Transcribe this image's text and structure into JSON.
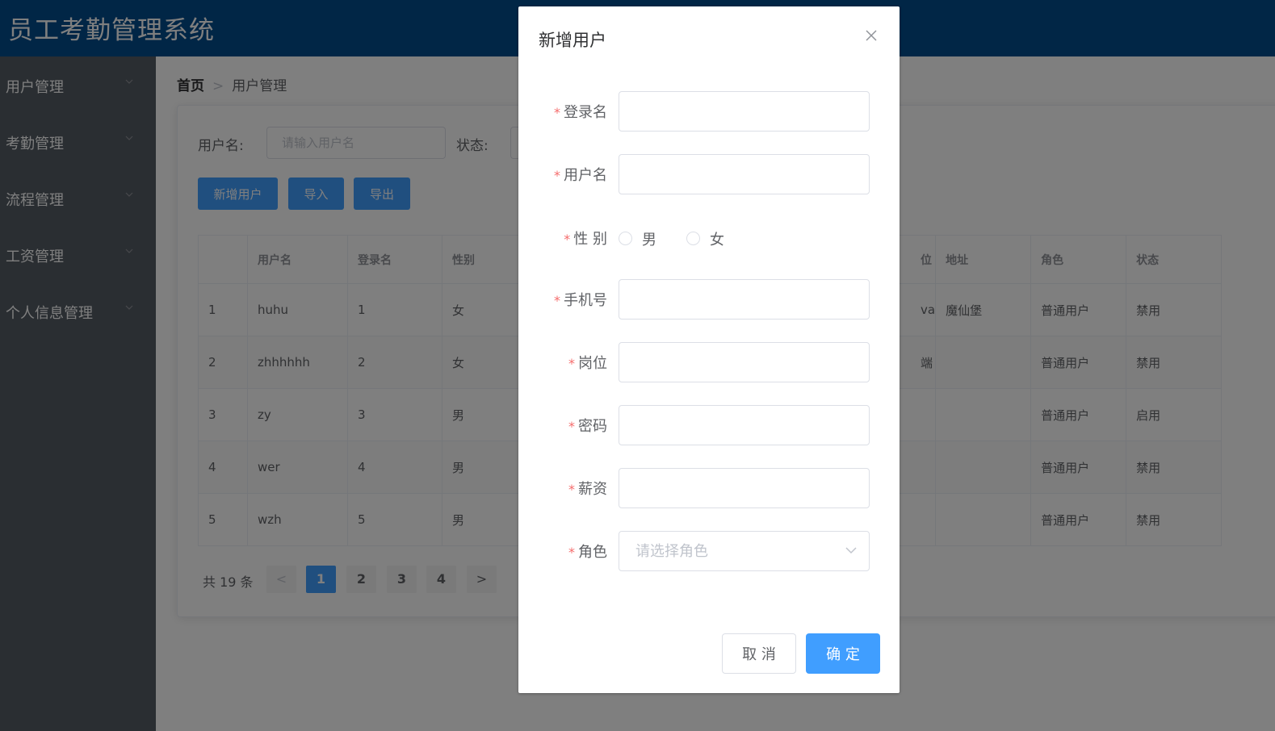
{
  "app": {
    "title": "员工考勤管理系统"
  },
  "sidebar": {
    "items": [
      {
        "label": "用户管理"
      },
      {
        "label": "考勤管理"
      },
      {
        "label": "流程管理"
      },
      {
        "label": "工资管理"
      },
      {
        "label": "个人信息管理"
      }
    ]
  },
  "breadcrumb": {
    "home": "首页",
    "separator": ">",
    "current": "用户管理"
  },
  "filters": {
    "username_label": "用户名:",
    "username_placeholder": "请输入用户名",
    "status_label": "状态:"
  },
  "toolbar": {
    "add_label": "新增用户",
    "import_label": "导入",
    "export_label": "导出"
  },
  "table": {
    "headers": [
      "",
      "用户名",
      "登录名",
      "性别",
      "位",
      "地址",
      "角色",
      "状态"
    ],
    "rows": [
      [
        "1",
        "huhu",
        "1",
        "女",
        "va",
        "魔仙堡",
        "普通用户",
        "禁用"
      ],
      [
        "2",
        "zhhhhhh",
        "2",
        "女",
        "端",
        "",
        "普通用户",
        "禁用"
      ],
      [
        "3",
        "zy",
        "3",
        "男",
        "",
        "",
        "普通用户",
        "启用"
      ],
      [
        "4",
        "wer",
        "4",
        "男",
        "",
        "",
        "普通用户",
        "禁用"
      ],
      [
        "5",
        "wzh",
        "5",
        "男",
        "",
        "",
        "普通用户",
        "禁用"
      ]
    ]
  },
  "pagination": {
    "total_text": "共 19 条",
    "pages": [
      "1",
      "2",
      "3",
      "4"
    ],
    "current_page": "1",
    "prev": "<",
    "next": ">"
  },
  "dialog": {
    "title": "新增用户",
    "required_mark": "*",
    "fields": {
      "login_name": "登录名",
      "username": "用户名",
      "gender": "性 别",
      "phone": "手机号",
      "position": "岗位",
      "password": "密码",
      "salary": "薪资",
      "role": "角色"
    },
    "gender_options": {
      "male": "男",
      "female": "女"
    },
    "role_placeholder": "请选择角色",
    "cancel_label": "取 消",
    "confirm_label": "确 定"
  },
  "colors": {
    "header_bg": "#034c8c",
    "sidebar_bg": "#545c64",
    "primary": "#409eff",
    "required": "#f56c6c"
  }
}
